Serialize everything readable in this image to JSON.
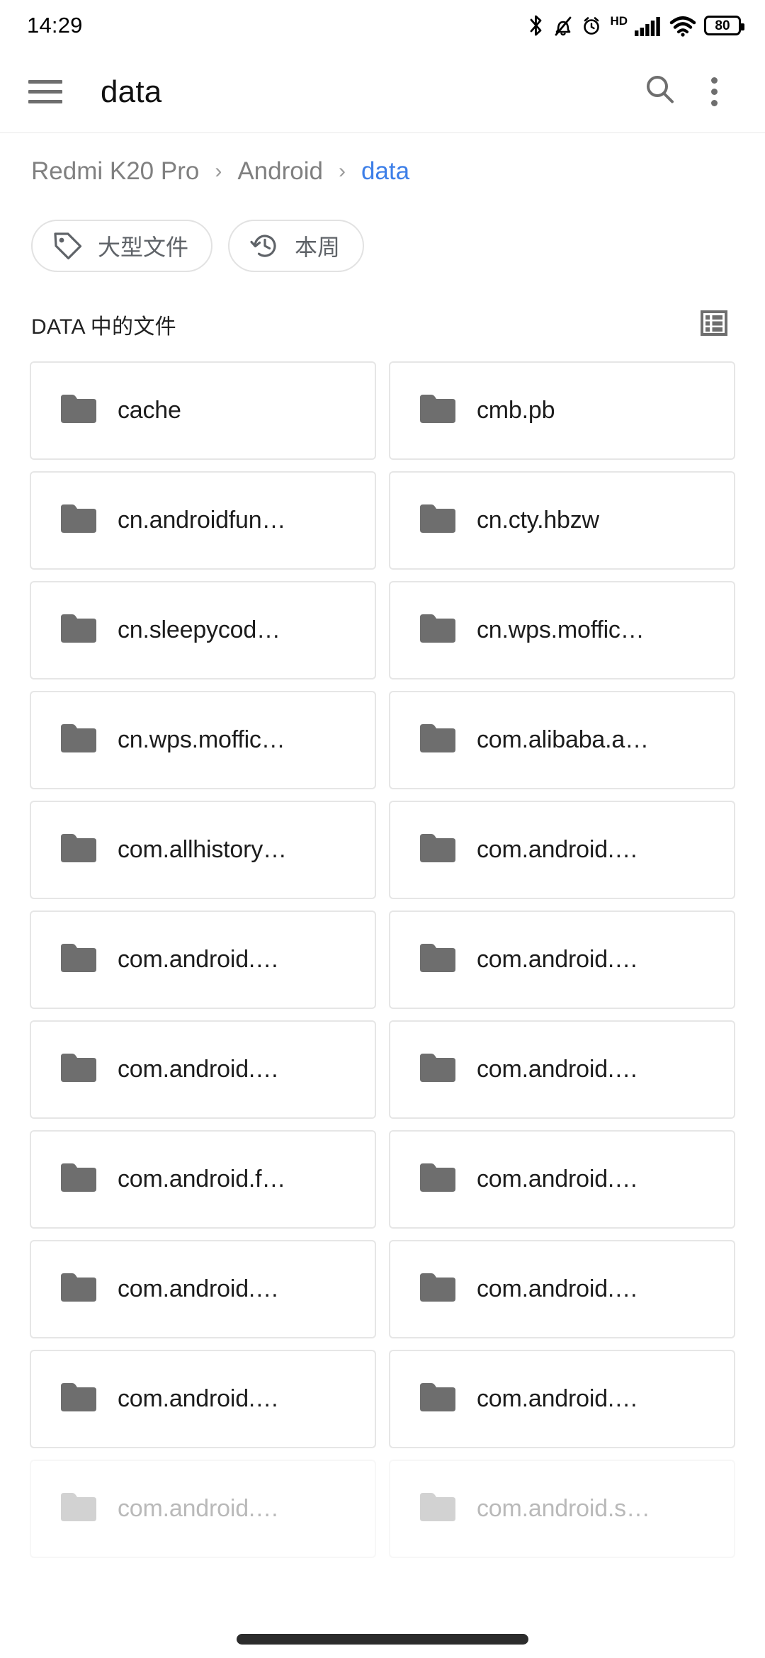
{
  "status_bar": {
    "time": "14:29",
    "battery_level": "80",
    "hd_label": "HD",
    "icons": [
      "bluetooth-icon",
      "silent-bell-icon",
      "alarm-icon",
      "hd-icon",
      "signal-icon",
      "wifi-icon",
      "battery-icon"
    ]
  },
  "app_bar": {
    "title": "data",
    "menu_icon": "hamburger-icon",
    "search_icon": "search-icon",
    "overflow_icon": "overflow-menu-icon"
  },
  "breadcrumb": {
    "separator": "›",
    "items": [
      {
        "label": "Redmi K20 Pro",
        "active": false
      },
      {
        "label": "Android",
        "active": false
      },
      {
        "label": "data",
        "active": true
      }
    ],
    "active_color": "#3d7fe8",
    "inactive_color": "#808080"
  },
  "chips": [
    {
      "label": "大型文件",
      "icon": "tag-icon"
    },
    {
      "label": "本周",
      "icon": "history-clock-icon"
    }
  ],
  "section": {
    "title": "DATA 中的文件",
    "view_toggle_icon": "list-view-icon"
  },
  "files": [
    {
      "name": "cache",
      "icon": "folder-icon",
      "faded": false
    },
    {
      "name": "cmb.pb",
      "icon": "folder-icon",
      "faded": false
    },
    {
      "name": "cn.androidfun…",
      "icon": "folder-icon",
      "faded": false
    },
    {
      "name": "cn.cty.hbzw",
      "icon": "folder-icon",
      "faded": false
    },
    {
      "name": "cn.sleepycod…",
      "icon": "folder-icon",
      "faded": false
    },
    {
      "name": "cn.wps.moffic…",
      "icon": "folder-icon",
      "faded": false
    },
    {
      "name": "cn.wps.moffic…",
      "icon": "folder-icon",
      "faded": false
    },
    {
      "name": "com.alibaba.a…",
      "icon": "folder-icon",
      "faded": false
    },
    {
      "name": "com.allhistory…",
      "icon": "folder-icon",
      "faded": false
    },
    {
      "name": "com.android.…",
      "icon": "folder-icon",
      "faded": false
    },
    {
      "name": "com.android.…",
      "icon": "folder-icon",
      "faded": false
    },
    {
      "name": "com.android.…",
      "icon": "folder-icon",
      "faded": false
    },
    {
      "name": "com.android.…",
      "icon": "folder-icon",
      "faded": false
    },
    {
      "name": "com.android.…",
      "icon": "folder-icon",
      "faded": false
    },
    {
      "name": "com.android.f…",
      "icon": "folder-icon",
      "faded": false
    },
    {
      "name": "com.android.…",
      "icon": "folder-icon",
      "faded": false
    },
    {
      "name": "com.android.…",
      "icon": "folder-icon",
      "faded": false
    },
    {
      "name": "com.android.…",
      "icon": "folder-icon",
      "faded": false
    },
    {
      "name": "com.android.…",
      "icon": "folder-icon",
      "faded": false
    },
    {
      "name": "com.android.…",
      "icon": "folder-icon",
      "faded": false
    },
    {
      "name": "com.android.…",
      "icon": "folder-icon",
      "faded": true
    },
    {
      "name": "com.android.s…",
      "icon": "folder-icon",
      "faded": true
    }
  ],
  "nav_bar": {
    "gesture_pill": "home-gesture-pill"
  },
  "colors": {
    "accent_blue": "#3d7fe8",
    "folder_gray": "#6e6e6e",
    "border_gray": "#e6e6e6",
    "text_primary": "#1c1c1c",
    "text_secondary": "#808080"
  }
}
